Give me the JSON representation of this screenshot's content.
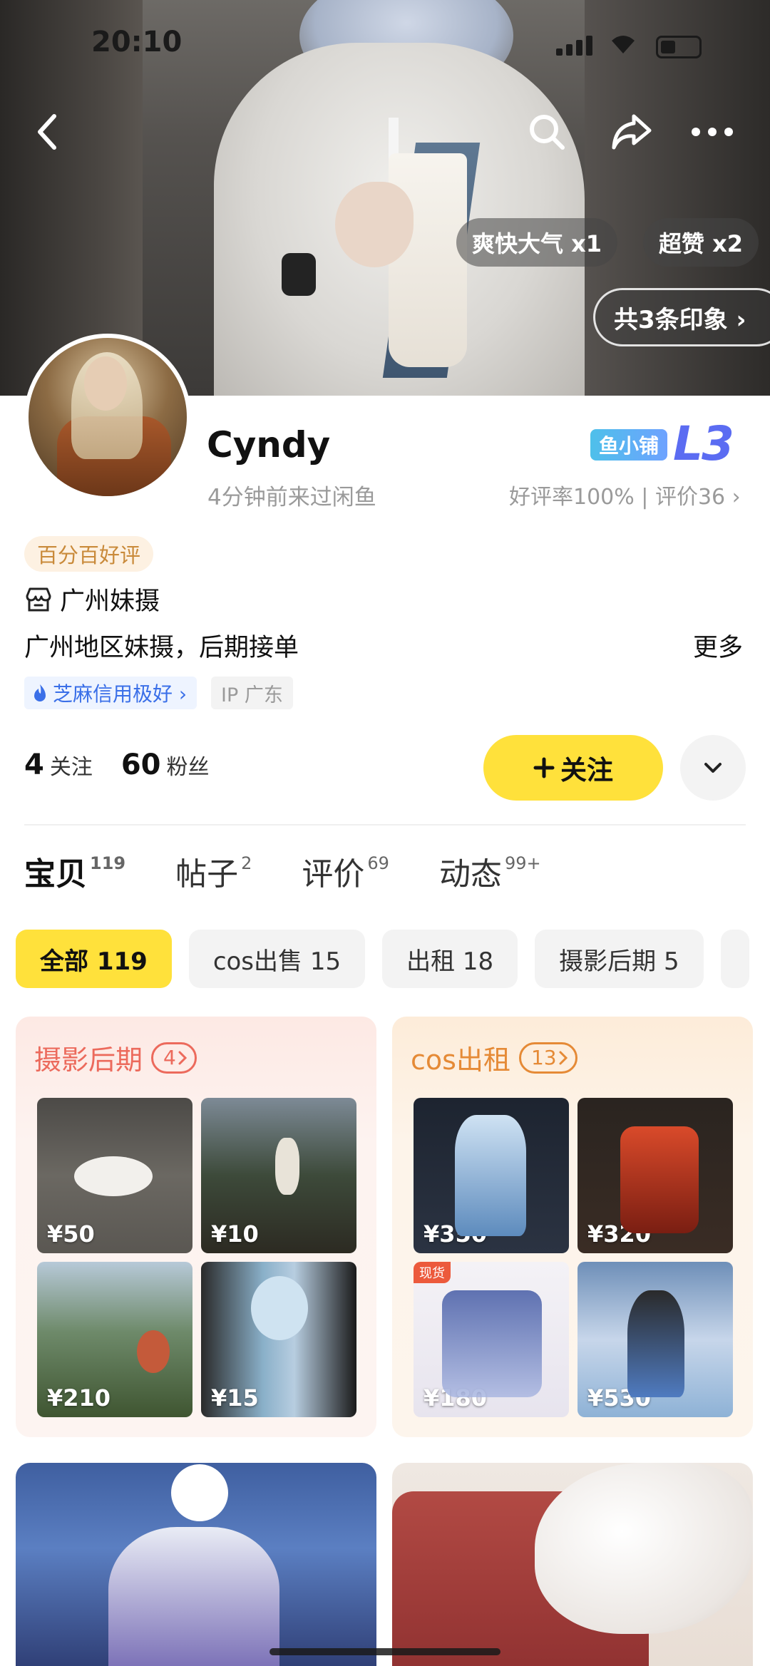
{
  "status_bar": {
    "time": "20:10"
  },
  "banner": {
    "chips": [
      {
        "label": "爽快大气 x1"
      },
      {
        "label": "超赞 x2"
      }
    ],
    "impressions_link": "共3条印象 ›"
  },
  "profile": {
    "name": "Cyndy",
    "last_seen": "4分钟前来过闲鱼",
    "shop_badge": "鱼小铺",
    "shop_level": "L3",
    "rating": "好评率100% | 评价36 ›",
    "good_tag": "百分百好评",
    "store_name": "广州妹摄",
    "bio": "广州地区妹摄，后期接单",
    "more": "更多",
    "credit": "芝麻信用极好 ›",
    "ip": "IP 广东",
    "following_count": "4",
    "following_label": "关注",
    "followers_count": "60",
    "followers_label": "粉丝",
    "follow_button": "关注"
  },
  "tabs": [
    {
      "label": "宝贝",
      "count": "119",
      "active": true
    },
    {
      "label": "帖子",
      "count": "2"
    },
    {
      "label": "评价",
      "count": "69"
    },
    {
      "label": "动态",
      "count": "99+"
    }
  ],
  "filters": [
    {
      "label": "全部 119",
      "active": true
    },
    {
      "label": "cos出售 15"
    },
    {
      "label": "出租 18"
    },
    {
      "label": "摄影后期 5"
    }
  ],
  "categories": [
    {
      "title": "摄影后期",
      "count": "4",
      "items": [
        {
          "price": "¥50"
        },
        {
          "price": "¥10"
        },
        {
          "price": "¥210"
        },
        {
          "price": "¥15"
        }
      ]
    },
    {
      "title": "cos出租",
      "count": "13",
      "items": [
        {
          "price": "¥350"
        },
        {
          "price": "¥320"
        },
        {
          "price": "¥180",
          "tag": "现货"
        },
        {
          "price": "¥530"
        }
      ]
    }
  ],
  "colors": {
    "accent_yellow": "#ffe13b",
    "photo_category": "#ec6a5c",
    "rental_category": "#e58a36",
    "credit_blue": "#3a6fe8"
  }
}
